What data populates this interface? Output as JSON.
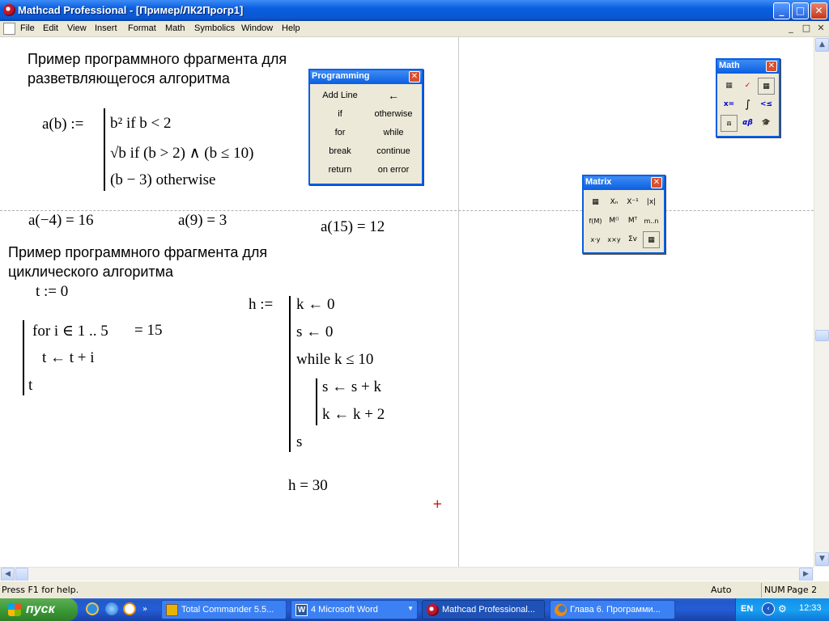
{
  "window": {
    "title": "Mathcad Professional - [Пример/ЛК2Прогр1]",
    "buttons": {
      "minimize": "_",
      "maximize": "□",
      "close": "✕"
    }
  },
  "menu": [
    "File",
    "Edit",
    "View",
    "Insert",
    "Format",
    "Math",
    "Symbolics",
    "Window",
    "Help"
  ],
  "mdi_buttons": {
    "minimize": "_",
    "restore": "□",
    "close": "✕"
  },
  "worksheet": {
    "heading1": [
      "Пример программного фрагмента для",
      "разветвляющегося алгоритма"
    ],
    "def_a": {
      "lhs": "a(b) :=",
      "line1": "b² if b < 2",
      "line2": "√b if (b > 2) ∧ (b ≤ 10)",
      "line3": "(b − 3) otherwise"
    },
    "results_a": [
      "a(−4) = 16",
      "a(9) = 3",
      "a(15) = 12"
    ],
    "heading2": [
      "Пример программного фрагмента для",
      "циклического алгоритма"
    ],
    "t_def": "t := 0",
    "loop": {
      "line1": "for i ∈ 1 .. 5",
      "result": "= 15",
      "line2": "t ← t + i",
      "line3": "t"
    },
    "h_def": {
      "lhs": "h :=",
      "line1": "k ← 0",
      "line2": "s ← 0",
      "line3": "while k ≤ 10",
      "line4": "s ← s + k",
      "line5": "k ← k + 2",
      "line6": "s"
    },
    "h_result": "h = 30",
    "cursor": "+"
  },
  "programming_toolbar": {
    "title": "Programming",
    "buttons": [
      "Add Line",
      "←",
      "if",
      "otherwise",
      "for",
      "while",
      "break",
      "continue",
      "return",
      "on error"
    ]
  },
  "math_toolbar": {
    "title": "Math",
    "icons": [
      "calculator-icon",
      "graph-icon",
      "matrix-icon",
      "evaluation-icon",
      "calculus-icon",
      "boolean-icon",
      "programming-icon",
      "greek-icon",
      "symbolic-icon"
    ],
    "glyphs": [
      "▦",
      "✓",
      "▦",
      "x=",
      "∫",
      "<≤",
      "⟎",
      "αβ",
      "🎓"
    ]
  },
  "matrix_toolbar": {
    "title": "Matrix",
    "glyphs": [
      "▦",
      "Xₙ",
      "X⁻¹",
      "|x|",
      "f(M)",
      "M⁽⁾",
      "Mᵀ",
      "m..n",
      "x·y",
      "x×y",
      "Σv",
      "▦"
    ]
  },
  "status_bar": {
    "help": "Press F1 for help.",
    "mode": "Auto",
    "num": "NUM",
    "page": "Page 2"
  },
  "taskbar": {
    "start": "пуск",
    "tasks": [
      "Total Commander 5.5...",
      "4 Microsoft Word",
      "Mathcad Professional...",
      "Глава 6. Программи..."
    ],
    "lang": "EN",
    "time": "12:33"
  },
  "colors": {
    "title_blue": "#0a5ee0",
    "taskbar_blue": "#245dd7",
    "start_green": "#3c9a37",
    "tray_blue": "#19a0f2",
    "cursor_red": "#d00000"
  }
}
